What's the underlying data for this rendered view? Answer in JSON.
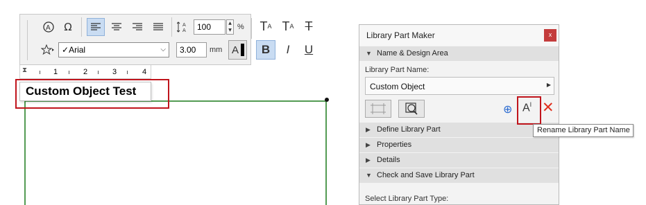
{
  "toolbar": {
    "font_name": "Arial",
    "font_check": "✓",
    "size_percent": "100",
    "percent_unit": "%",
    "height_value": "3.00",
    "height_unit": "mm",
    "bold_glyph": "B",
    "italic_glyph": "I",
    "underline_glyph": "U",
    "superscript_glyph": "T",
    "superscript_small": "A",
    "subscript_glyph": "T",
    "subscript_small": "A",
    "strike_glyph": "T",
    "color_glyph": "A"
  },
  "ruler": {
    "ticks": [
      "1",
      "2",
      "3",
      "4"
    ]
  },
  "canvas": {
    "text_label": "Custom Object Test",
    "line_color": "#1a7a1a"
  },
  "panel": {
    "title": "Library Part Maker",
    "close_glyph": "x",
    "sections": {
      "name_design": "Name & Design Area",
      "define": "Define Library Part",
      "properties": "Properties",
      "details": "Details",
      "check_save": "Check and Save Library Part"
    },
    "name_label": "Library Part Name:",
    "name_value": "Custom Object",
    "select_type_label": "Select Library Part Type:",
    "rename_icon_text": "A",
    "rename_icon_sup": "I"
  },
  "tooltip": "Rename Library Part Name",
  "colors": {
    "accent_red": "#c0141c",
    "highlight_blue": "#c9dcf2",
    "close_red": "#c43c3c"
  }
}
